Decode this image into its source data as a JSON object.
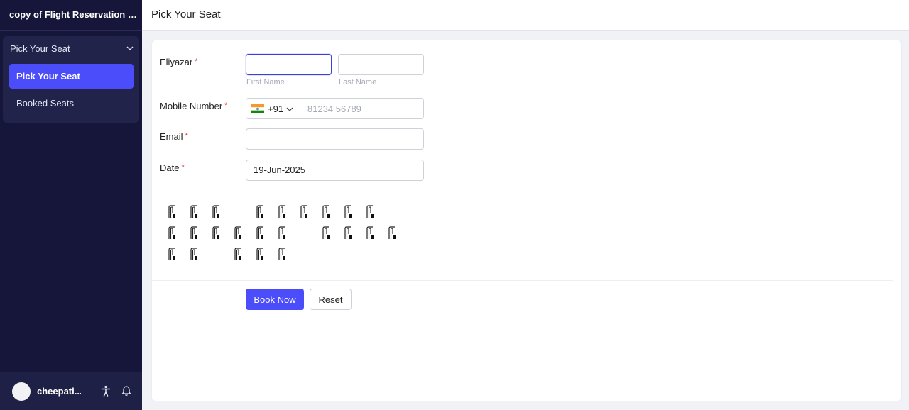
{
  "app": {
    "title": "copy of Flight Reservation Sys..."
  },
  "sidebar": {
    "group_label": "Pick Your Seat",
    "items": [
      {
        "label": "Pick Your Seat",
        "active": true
      },
      {
        "label": "Booked Seats",
        "active": false
      }
    ],
    "user": {
      "name": "cheepati..."
    },
    "icons": [
      "chevron-down-icon",
      "accessibility-icon",
      "bell-icon"
    ]
  },
  "header": {
    "title": "Pick Your Seat"
  },
  "form": {
    "name": {
      "label": "Eliyazar",
      "required": "*",
      "first_hint": "First Name",
      "last_hint": "Last Name",
      "first_value": "",
      "last_value": ""
    },
    "mobile": {
      "label": "Mobile Number",
      "required": "*",
      "country_code": "+91",
      "placeholder": "81234 56789",
      "flag": "india-flag-icon"
    },
    "email": {
      "label": "Email",
      "required": "*",
      "value": ""
    },
    "date": {
      "label": "Date",
      "required": "*",
      "value": "19-Jun-2025"
    }
  },
  "seat_map": {
    "icon": "seat-icon",
    "rows": [
      [
        1,
        1,
        1,
        0,
        1,
        1,
        1,
        1,
        1,
        1,
        0
      ],
      [
        1,
        1,
        1,
        1,
        1,
        1,
        0,
        1,
        1,
        1,
        1
      ],
      [
        1,
        1,
        0,
        1,
        1,
        1,
        0,
        0,
        0,
        0,
        0
      ]
    ]
  },
  "actions": {
    "book_label": "Book Now",
    "reset_label": "Reset"
  },
  "colors": {
    "sidebar_bg": "#16163a",
    "accent": "#4b4dfa",
    "required": "#e53b3b"
  }
}
